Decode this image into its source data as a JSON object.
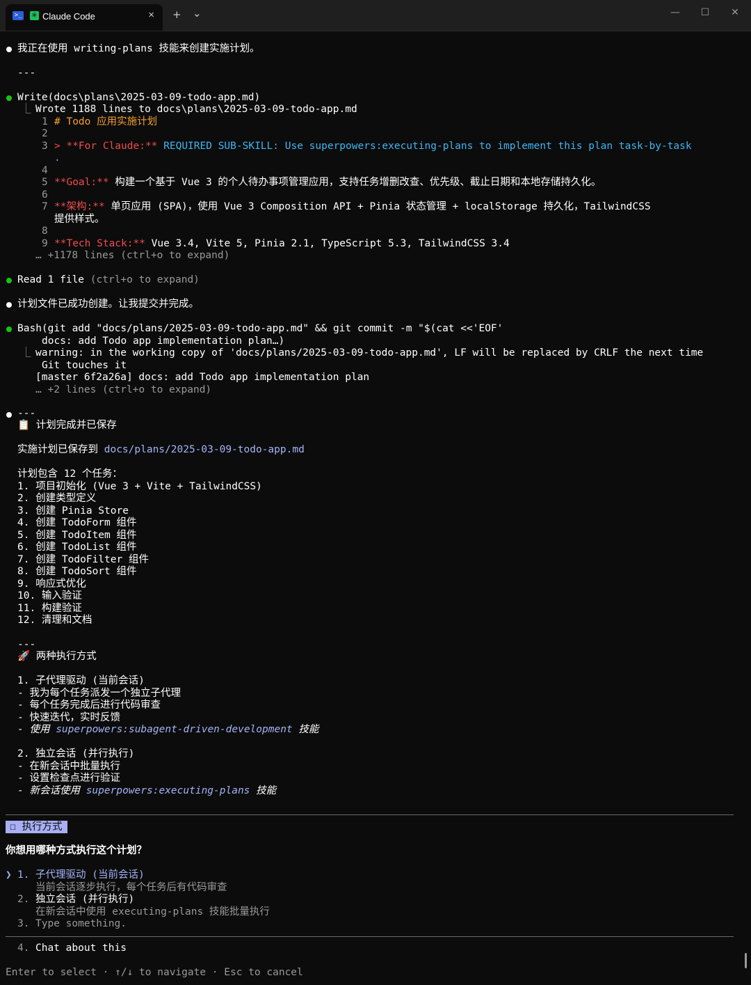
{
  "window": {
    "tab_title": "Claude Code",
    "new_tab": "+",
    "dropdown": "⌄",
    "close_tab": "×",
    "minimize": "—",
    "maximize": "☐",
    "close": "✕"
  },
  "colors": {
    "accent": "#a8aff5",
    "bullet_done": "#16c60c",
    "heading": "#f4a02a"
  },
  "terminal": {
    "l1": "我正在使用 writing-plans 技能来创建实施计划。",
    "sep1": "---",
    "write_cmd": "Write(docs\\plans\\2025-03-09-todo-app.md)",
    "write_result": "Wrote 1188 lines to docs\\plans\\2025-03-09-todo-app.md",
    "file": {
      "n1": "1",
      "t1": "# Todo 应用实施计划",
      "n2": "2",
      "n3": "3",
      "t3a": "> **For Claude:**",
      "t3b": " REQUIRED SUB-SKILL: Use superpowers:executing-plans to implement this plan task-by-task",
      "t3c": ".",
      "n4": "4",
      "n5": "5",
      "t5a": "**Goal:**",
      "t5b": " 构建一个基于 Vue 3 的个人待办事项管理应用，支持任务增删改查、优先级、截止日期和本地存储持久化。",
      "n6": "6",
      "n7": "7",
      "t7a": "**架构:**",
      "t7b": " 单页应用 (SPA)，使用 Vue 3 Composition API + Pinia 状态管理 + localStorage 持久化，TailwindCSS",
      "t7c": "提供样式。",
      "n8": "8",
      "n9": "9",
      "t9a": "**Tech Stack:**",
      "t9b": " Vue 3.4, Vite 5, Pinia 2.1, TypeScript 5.3, TailwindCSS 3.4"
    },
    "expand1": "… +1178 lines (ctrl+o to expand)",
    "read_a": "Read ",
    "read_b": "1 file",
    "read_c": " (ctrl+o to expand)",
    "l_done": "计划文件已成功创建。让我提交并完成。",
    "bash1": "Bash(git add \"docs/plans/2025-03-09-todo-app.md\" && git commit -m \"$(cat <<'EOF'",
    "bash2": "docs: add Todo app implementation plan…)",
    "warn1": "warning: in the working copy of 'docs/plans/2025-03-09-todo-app.md', LF will be replaced by CRLF the next time",
    "warn2": "Git touches it",
    "master": "[master 6f2a26a] docs: add Todo app implementation plan",
    "expand2": "… +2 lines (ctrl+o to expand)",
    "sep2": "---",
    "saved_icon": "📋",
    "saved_title": "计划完成并已保存",
    "saved_to_label": "实施计划已保存到 ",
    "saved_to_path": "docs/plans/2025-03-09-todo-app.md",
    "tasks_intro": "计划包含 12 个任务：",
    "tasks": [
      "1. 项目初始化 (Vue 3 + Vite + TailwindCSS)",
      "2. 创建类型定义",
      "3. 创建 Pinia Store",
      "4. 创建 TodoForm 组件",
      "5. 创建 TodoItem 组件",
      "6. 创建 TodoList 组件",
      "7. 创建 TodoFilter 组件",
      "8. 创建 TodoSort 组件",
      "9. 响应式优化",
      "10. 输入验证",
      "11. 构建验证",
      "12. 清理和文档"
    ],
    "sep3": "---",
    "modes_icon": "🚀",
    "modes_title": "两种执行方式",
    "m1_title": "1. 子代理驱动 (当前会话)",
    "m1_a": "- 我为每个任务派发一个独立子代理",
    "m1_b": "- 每个任务完成后进行代码审查",
    "m1_c": "- 快速迭代，实时反馈",
    "m1_d1": "- ",
    "m1_d2": "使用 ",
    "m1_d3": "superpowers:subagent-driven-development",
    "m1_d4": " 技能",
    "m2_title": "2. 独立会话 (并行执行)",
    "m2_a": "- 在新会话中批量执行",
    "m2_b": "- 设置检查点进行验证",
    "m2_c1": "- ",
    "m2_c2": "新会话使用 ",
    "m2_c3": "superpowers:executing-plans",
    "m2_c4": " 技能"
  },
  "prompt": {
    "badge": "☐ 执行方式",
    "question": "你想用哪种方式执行这个计划？",
    "cursor": "❯",
    "options": [
      {
        "num": "1.",
        "label": "子代理驱动 (当前会话)",
        "desc": "当前会话逐步执行，每个任务后有代码审查"
      },
      {
        "num": "2.",
        "label": "独立会话 (并行执行)",
        "desc": "在新会话中使用 executing-plans 技能批量执行"
      },
      {
        "num": "3.",
        "label": "Type something."
      },
      {
        "num": "4.",
        "label": "Chat about this"
      }
    ],
    "footer": "Enter to select · ↑/↓ to navigate · Esc to cancel"
  }
}
